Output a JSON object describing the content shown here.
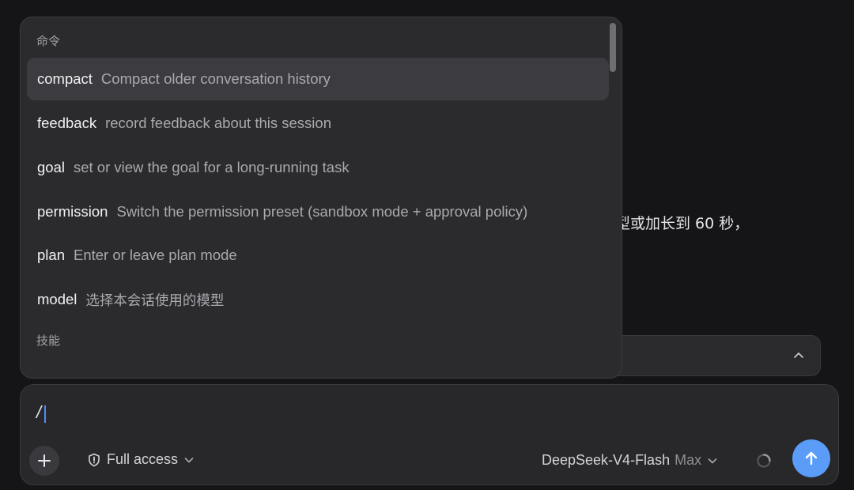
{
  "background": {
    "message_fragment": "色造型或加长到 60 秒，"
  },
  "popup": {
    "commands_label": "命令",
    "commands": [
      {
        "name": "compact",
        "description": "Compact older conversation history"
      },
      {
        "name": "feedback",
        "description": "record feedback about this session"
      },
      {
        "name": "goal",
        "description": "set or view the goal for a long-running task"
      },
      {
        "name": "permission",
        "description": "Switch the permission preset (sandbox mode + approval policy)"
      },
      {
        "name": "plan",
        "description": "Enter or leave plan mode"
      },
      {
        "name": "model",
        "description": "选择本会话使用的模型"
      }
    ],
    "skills_label": "技能"
  },
  "composer": {
    "input_value": "/",
    "access_label": "Full access",
    "model_name": "DeepSeek-V4-Flash",
    "model_tier": "Max"
  },
  "icons": {
    "plus": "plus-icon",
    "shield": "shield-icon",
    "chevron": "chevron-down-icon",
    "spinner": "loading-spinner-icon",
    "send": "arrow-up-icon",
    "collapse": "chevron-up-icon"
  },
  "colors": {
    "background": "#151517",
    "popup": "#2b2b2e",
    "active_row": "#3c3c40",
    "send_button": "#5a9cf8"
  }
}
